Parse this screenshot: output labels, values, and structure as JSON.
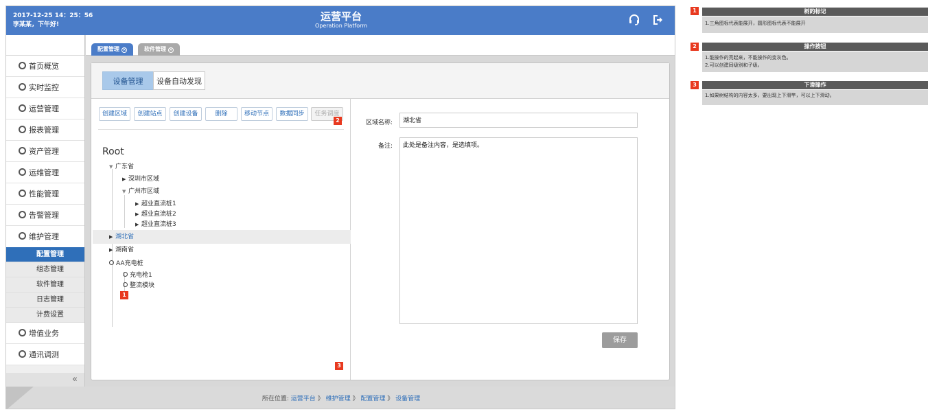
{
  "header": {
    "datetime": "2017-12-25  14：25：56",
    "greeting": "李某某，下午好!",
    "title_cn": "运营平台",
    "title_en": "Operation Platform",
    "icons": [
      "headset-icon",
      "logout-icon"
    ]
  },
  "sidebar": {
    "items": [
      {
        "label": "首页概览"
      },
      {
        "label": "实时监控"
      },
      {
        "label": "运营管理"
      },
      {
        "label": "报表管理"
      },
      {
        "label": "资产管理"
      },
      {
        "label": "运维管理"
      },
      {
        "label": "性能管理"
      },
      {
        "label": "告警管理"
      },
      {
        "label": "维护管理"
      }
    ],
    "submenu": [
      {
        "label": "配置管理"
      },
      {
        "label": "组态管理"
      },
      {
        "label": "软件管理"
      },
      {
        "label": "日志管理"
      },
      {
        "label": "计费设置"
      }
    ],
    "items_after": [
      {
        "label": "增值业务"
      },
      {
        "label": "通讯调测"
      }
    ],
    "collapse": "«"
  },
  "tabs": [
    {
      "label": "配置管理",
      "close": "×"
    },
    {
      "label": "软件管理",
      "close": "×"
    }
  ],
  "subtabs": [
    {
      "label": "设备管理"
    },
    {
      "label": "设备自动发现"
    }
  ],
  "toolbar": [
    {
      "label": "创建区域"
    },
    {
      "label": "创建站点"
    },
    {
      "label": "创建设备"
    },
    {
      "label": "删除"
    },
    {
      "label": "移动节点"
    },
    {
      "label": "数据同步"
    },
    {
      "label": "任务调度"
    }
  ],
  "tree": {
    "root": "Root",
    "nodes": [
      {
        "label": "广东省"
      },
      {
        "label": "深圳市区域"
      },
      {
        "label": "广州市区域"
      },
      {
        "label": "超业直流桩1"
      },
      {
        "label": "超业直流桩2"
      },
      {
        "label": "超业直流桩3"
      },
      {
        "label": "湖北省"
      },
      {
        "label": "湖南省"
      },
      {
        "label": "AA充电桩"
      },
      {
        "label": "充电枪1"
      },
      {
        "label": "整流模块"
      }
    ],
    "caret_down": "▼",
    "caret_right": "▶"
  },
  "form": {
    "region_label": "区域名称:",
    "region_value": "湖北省",
    "note_label": "备注:",
    "note_value": "此处是备注内容，是选填项。",
    "save": "保存"
  },
  "markers": [
    "1",
    "2",
    "3"
  ],
  "footer": {
    "prefix": "所在位置:",
    "crumbs": [
      "运营平台",
      "维护管理",
      "配置管理",
      "设备管理"
    ],
    "sep": " 》"
  },
  "annotations": [
    {
      "num": "1",
      "title": "树的标记",
      "lines": [
        "1.三角图标代表能展开，圆形图标代表不能展开"
      ]
    },
    {
      "num": "2",
      "title": "操作按钮",
      "lines": [
        "1.能操作的亮起来，不能操作的变灰色。",
        "2.可以创建同级别和子级。"
      ]
    },
    {
      "num": "3",
      "title": "下滑操作",
      "lines": [
        "1.如果树结构的内容太多，要出现上下滑竿，可以上下滑动。"
      ]
    }
  ],
  "colors": {
    "header_blue": "#4a7cc8",
    "active_blue": "#2f6fb9",
    "marker_red": "#e8391f",
    "tab_grey": "#a9a9a9"
  }
}
